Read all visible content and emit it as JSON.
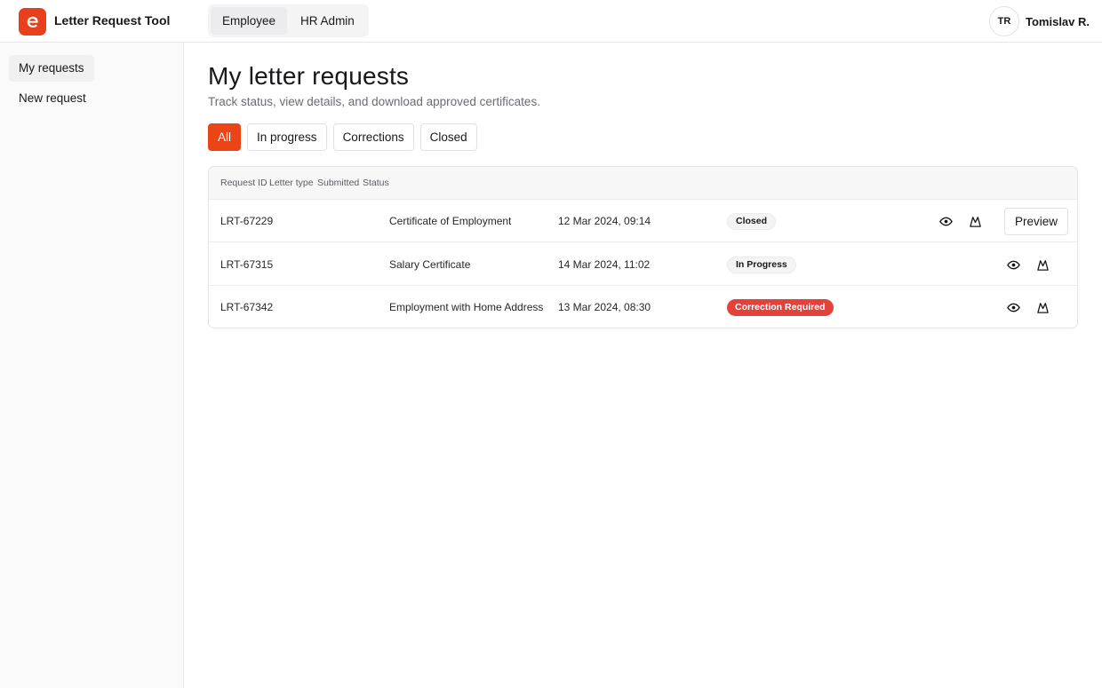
{
  "header": {
    "logo_icon": "brand-logo-icon",
    "app_title": "Letter Request Tool",
    "roles": [
      {
        "label": "Employee",
        "active": true
      },
      {
        "label": "HR Admin",
        "active": false
      }
    ],
    "user": {
      "initials": "TR",
      "name": "Tomislav R."
    }
  },
  "sidebar": {
    "items": [
      {
        "label": "My requests",
        "active": true
      },
      {
        "label": "New request",
        "active": false
      }
    ]
  },
  "main": {
    "title": "My letter requests",
    "subtitle": "Track status, view details, and download approved certificates.",
    "filters": [
      {
        "label": "All",
        "active": true
      },
      {
        "label": "In progress",
        "active": false
      },
      {
        "label": "Corrections",
        "active": false
      },
      {
        "label": "Closed",
        "active": false
      }
    ],
    "table": {
      "headers": [
        "Request ID",
        "Letter type",
        "Submitted",
        "Status"
      ],
      "rows": [
        {
          "id": "LRT-67229",
          "type": "Certificate of Employment",
          "submitted": "12 Mar 2024, 09:14",
          "status": "Closed",
          "status_style": "neutral",
          "preview_label": "Preview"
        },
        {
          "id": "LRT-67315",
          "type": "Salary Certificate",
          "submitted": "14 Mar 2024, 11:02",
          "status": "In Progress",
          "status_style": "neutral"
        },
        {
          "id": "LRT-67342",
          "type": "Employment with Home Address",
          "submitted": "13 Mar 2024, 08:30",
          "status": "Correction Required",
          "status_style": "danger"
        }
      ],
      "row_icons": [
        "eye-icon",
        "download-icon"
      ]
    }
  },
  "colors": {
    "accent": "#ea4417",
    "danger": "#e5413b",
    "text": "#18181b",
    "muted": "#6b6b72"
  }
}
